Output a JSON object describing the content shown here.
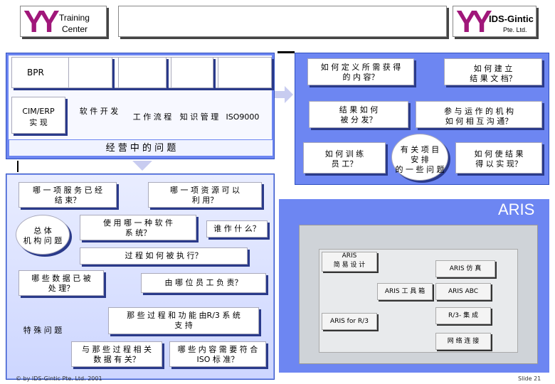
{
  "header": {
    "training_line1": "Training",
    "training_line2": "Center",
    "company_name": "IDS-Gintic",
    "company_sub": "Pte. Ltd.",
    "logo_mark": "YY"
  },
  "top_panel": {
    "bpr": "BPR",
    "cim_erp_1": "CIM/ERP",
    "cim_erp_2": "实 现",
    "software": "软 件 开 发",
    "workflow": "工 作 流 程",
    "km": "知 识 管 理",
    "iso": "ISO9000",
    "business_issue": "经 营 中 的 问 题"
  },
  "right_panel": {
    "q1_1": "如 何 定 义 所 需 获 得",
    "q1_2": "的 内 容？",
    "q2_1": "如 何 建 立",
    "q2_2": "结 果 文 档？",
    "q3_1": "结 果 如 何",
    "q3_2": "被 分 发？",
    "q4_1": "参 与 运 作 的 机 构",
    "q4_2": "如 何 相 互 沟 通？",
    "q5_1": "如 何 训 练",
    "q5_2": "员 工？",
    "q6_1": "有 关 项 目",
    "q6_2": "安 排",
    "q6_3": "的 一 些 问 题",
    "q7_1": "如 何 使 结 果",
    "q7_2": "得 以 实 现？"
  },
  "bottom_panel": {
    "service_1": "哪 一 项 服 务 已 经",
    "service_2": "结 束？",
    "resource_1": "哪 一 项 资 源 可 以",
    "resource_2": "利 用？",
    "overall_1": "总 体",
    "overall_2": "机 构 问 题",
    "software_used_1": "使 用 哪 一 种 软 件",
    "software_used_2": "系 统？",
    "who_does": "谁 作 什 么？",
    "process_exec": "过 程 如 何 被 执 行？",
    "data_1": "哪 些 数 据 已 被",
    "data_2": "处 理？",
    "staff": "由 哪 位 员 工 负 责？",
    "r3_1": "那 些 过 程 和 功 能 由R/3 系 统",
    "r3_2": "支 持",
    "special": "特 殊 问 题",
    "process_data_1": "与 那 些 过 程 相 关",
    "process_data_2": "数 据 有 关？",
    "iso_content_1": "哪 些 内 容 需 要 符 合",
    "iso_content_2": "ISO 标 准？"
  },
  "aris": {
    "title": "ARIS",
    "design_1": "ARIS",
    "design_2": "简 易 设 计",
    "simulation": "ARIS 仿 真",
    "toolset": "ARIS 工 具 箱",
    "abc": "ARIS ABC",
    "r3": "ARIS for R/3",
    "r3_integration": "R/3- 集 成",
    "network": "网 络 连 接"
  },
  "footer": {
    "copyright": "© by IDS-Gintic Pte. Ltd. 2001",
    "slide": "Slide 21"
  },
  "colors": {
    "panel_blue": "#6d86f2",
    "logo_magenta": "#a0177a"
  }
}
